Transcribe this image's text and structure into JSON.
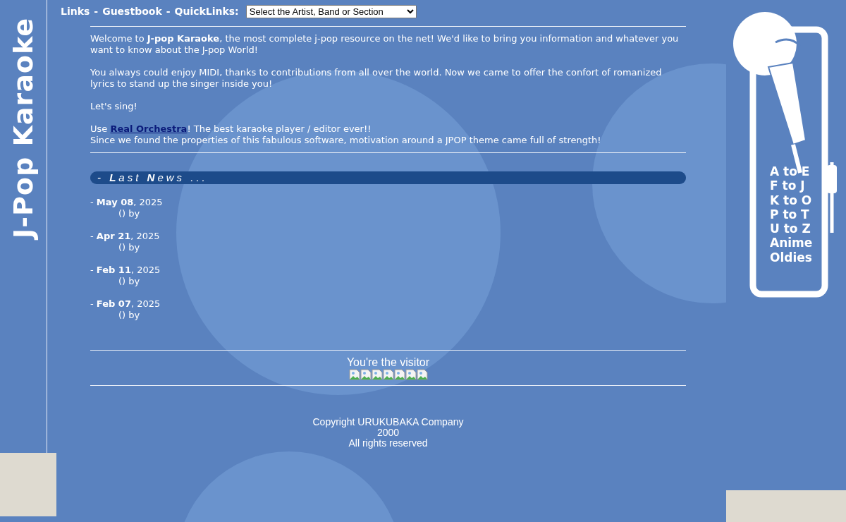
{
  "side_logo": {
    "text": "J-Pop Karaoke"
  },
  "header": {
    "items": [
      {
        "kind": "link",
        "text": "Links"
      },
      {
        "kind": "sep",
        "text": "-"
      },
      {
        "kind": "link",
        "text": "Guestbook"
      },
      {
        "kind": "sep",
        "text": "-"
      },
      {
        "kind": "label",
        "text": "QuickLinks:"
      }
    ],
    "quicklinks_select": {
      "value": "Select the Artist, Band or Section"
    }
  },
  "intro": [
    {
      "kind": "text",
      "text": "Welcome to **J-pop Karaoke**, the most complete j-pop resource on the net! We'd like to bring you information and whatever you want to know about the J-pop World!"
    },
    {
      "kind": "text",
      "text": "You always could enjoy MIDI, thanks to contributions from all over the world. Now we came to offer the confort of romanized lyrics to stand up the singer inside you!"
    },
    {
      "kind": "text",
      "text": "Let's sing!"
    },
    {
      "kind": "link",
      "before": "Use",
      "link": "Real Orchestra",
      "after": "! The best karaoke player / editor ever!!",
      "line2": "Since we found the properties of this fabulous software, motivation around a JPOP theme came full of strength!"
    }
  ],
  "news_heading": {
    "dash": "-",
    "word1_initial": "L",
    "word1_rest": "ast",
    "word2_initial": "N",
    "word2_rest": "ews",
    "dots": "..."
  },
  "news": [
    {
      "date": "- **May 08**, 2025",
      "byline": "() by"
    },
    {
      "date": "- **Apr 21**, 2025",
      "byline": "() by"
    },
    {
      "date": "- **Feb 11**, 2025",
      "byline": "() by"
    },
    {
      "date": "- **Feb 07**, 2025",
      "byline": "() by"
    }
  ],
  "visitor": {
    "label": "You're the visitor",
    "counter_images": [
      {
        "kind": "broken"
      },
      {
        "kind": "broken"
      },
      {
        "kind": "broken"
      },
      {
        "kind": "broken"
      },
      {
        "kind": "broken"
      },
      {
        "kind": "broken"
      },
      {
        "kind": "broken"
      }
    ]
  },
  "copyright": [
    "Copyright URUKUBAKA Company",
    "2000",
    "All rights reserved"
  ],
  "sections": [
    "A to E",
    "F to J",
    "K to O",
    "P to T",
    "U to Z",
    "Anime",
    "Oldies"
  ]
}
